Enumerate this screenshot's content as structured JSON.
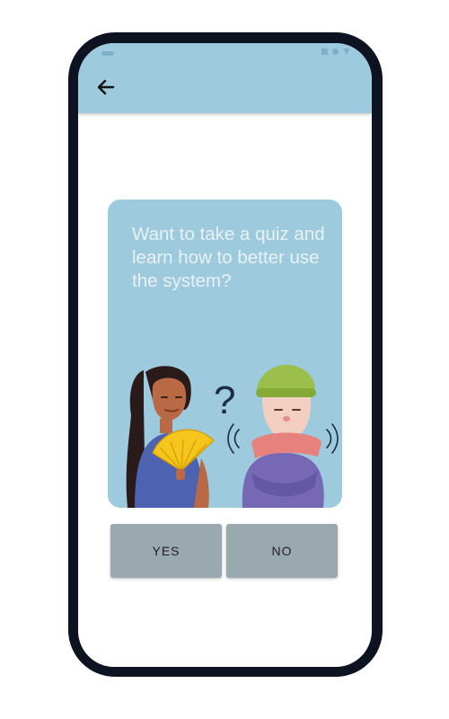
{
  "app": {
    "back_icon": "arrow-left-icon"
  },
  "card": {
    "question": "Want to take a quiz and learn how to better use the system?",
    "illustration": "woman-fanning-and-man-shivering-illustration"
  },
  "actions": {
    "yes_label": "YES",
    "no_label": "NO"
  },
  "colors": {
    "accent": "#9dcbdd",
    "button": "#9aa8af",
    "frame": "#0d1320"
  }
}
